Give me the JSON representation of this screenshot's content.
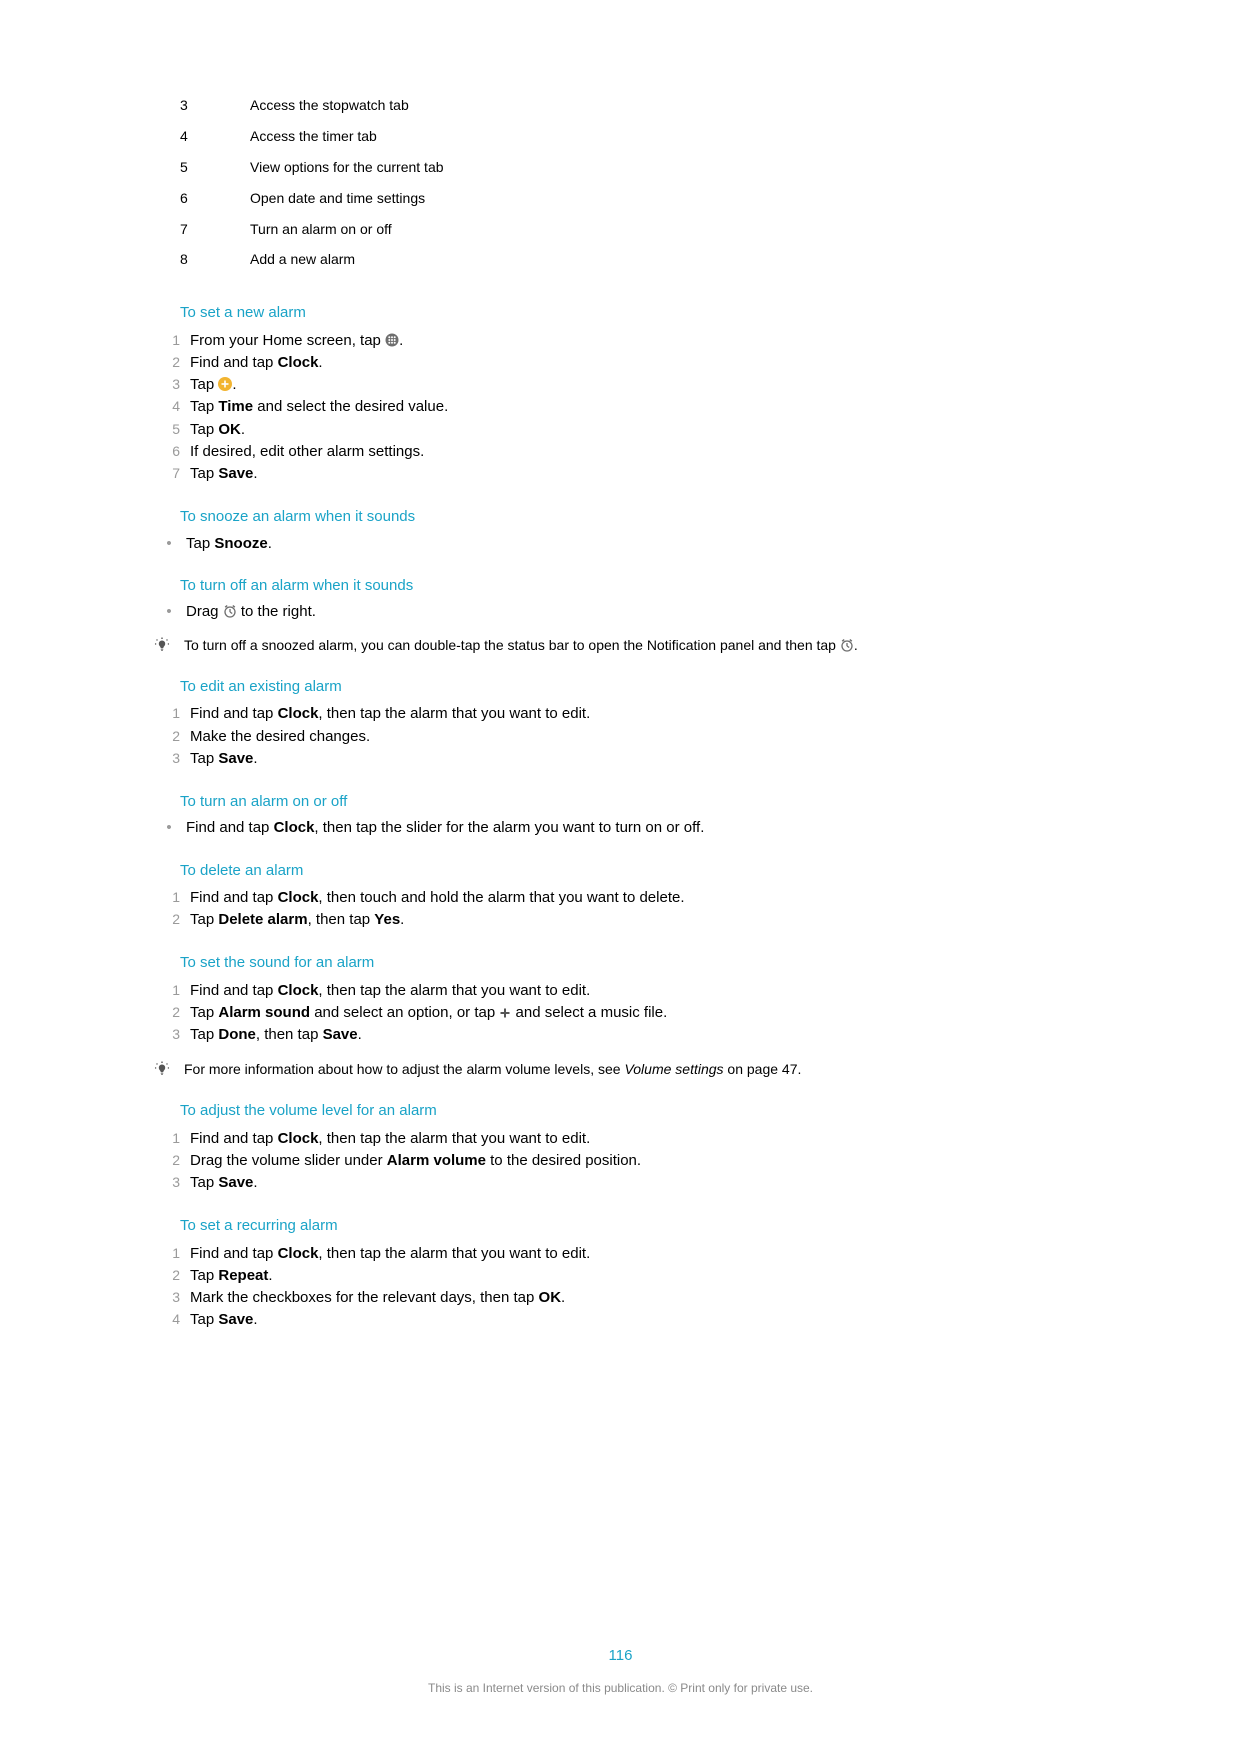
{
  "legend": [
    {
      "n": "3",
      "text": "Access the stopwatch tab"
    },
    {
      "n": "4",
      "text": "Access the timer tab"
    },
    {
      "n": "5",
      "text": "View options for the current tab"
    },
    {
      "n": "6",
      "text": "Open date and time settings"
    },
    {
      "n": "7",
      "text": "Turn an alarm on or off"
    },
    {
      "n": "8",
      "text": "Add a new alarm"
    }
  ],
  "s1": {
    "heading": "To set a new alarm",
    "steps": {
      "n1": "1",
      "t1a": "From your Home screen, tap ",
      "t1b": ".",
      "n2": "2",
      "t2a": "Find and tap ",
      "t2b": "Clock",
      "t2c": ".",
      "n3": "3",
      "t3a": "Tap ",
      "t3b": ".",
      "n4": "4",
      "t4a": "Tap ",
      "t4b": "Time",
      "t4c": " and select the desired value.",
      "n5": "5",
      "t5a": "Tap ",
      "t5b": "OK",
      "t5c": ".",
      "n6": "6",
      "t6": "If desired, edit other alarm settings.",
      "n7": "7",
      "t7a": "Tap ",
      "t7b": "Save",
      "t7c": "."
    }
  },
  "s2": {
    "heading": "To snooze an alarm when it sounds",
    "bullet": {
      "ta": "Tap ",
      "tb": "Snooze",
      "tc": "."
    }
  },
  "s3": {
    "heading": "To turn off an alarm when it sounds",
    "bullet": {
      "ta": "Drag ",
      "tb": " to the right."
    },
    "tip": {
      "ta": "To turn off a snoozed alarm, you can double-tap the status bar to open the Notification panel and then tap ",
      "tb": "."
    }
  },
  "s4": {
    "heading": "To edit an existing alarm",
    "steps": {
      "n1": "1",
      "t1a": "Find and tap ",
      "t1b": "Clock",
      "t1c": ", then tap the alarm that you want to edit.",
      "n2": "2",
      "t2": "Make the desired changes.",
      "n3": "3",
      "t3a": "Tap ",
      "t3b": "Save",
      "t3c": "."
    }
  },
  "s5": {
    "heading": "To turn an alarm on or off",
    "bullet": {
      "ta": "Find and tap ",
      "tb": "Clock",
      "tc": ", then tap the slider for the alarm you want to turn on or off."
    }
  },
  "s6": {
    "heading": "To delete an alarm",
    "steps": {
      "n1": "1",
      "t1a": "Find and tap ",
      "t1b": "Clock",
      "t1c": ", then touch and hold the alarm that you want to delete.",
      "n2": "2",
      "t2a": "Tap ",
      "t2b": "Delete alarm",
      "t2c": ", then tap ",
      "t2d": "Yes",
      "t2e": "."
    }
  },
  "s7": {
    "heading": "To set the sound for an alarm",
    "steps": {
      "n1": "1",
      "t1a": "Find and tap ",
      "t1b": "Clock",
      "t1c": ", then tap the alarm that you want to edit.",
      "n2": "2",
      "t2a": "Tap ",
      "t2b": "Alarm sound",
      "t2c": " and select an option, or tap ",
      "t2d": " and select a music file.",
      "n3": "3",
      "t3a": "Tap ",
      "t3b": "Done",
      "t3c": ", then tap ",
      "t3d": "Save",
      "t3e": "."
    },
    "tip": {
      "ta": "For more information about how to adjust the alarm volume levels, see ",
      "tb": "Volume settings",
      "tc": " on page 47."
    }
  },
  "s8": {
    "heading": "To adjust the volume level for an alarm",
    "steps": {
      "n1": "1",
      "t1a": "Find and tap ",
      "t1b": "Clock",
      "t1c": ", then tap the alarm that you want to edit.",
      "n2": "2",
      "t2a": "Drag the volume slider under ",
      "t2b": "Alarm volume",
      "t2c": " to the desired position.",
      "n3": "3",
      "t3a": "Tap ",
      "t3b": "Save",
      "t3c": "."
    }
  },
  "s9": {
    "heading": "To set a recurring alarm",
    "steps": {
      "n1": "1",
      "t1a": "Find and tap ",
      "t1b": "Clock",
      "t1c": ", then tap the alarm that you want to edit.",
      "n2": "2",
      "t2a": "Tap ",
      "t2b": "Repeat",
      "t2c": ".",
      "n3": "3",
      "t3a": "Mark the checkboxes for the relevant days, then tap ",
      "t3b": "OK",
      "t3c": ".",
      "n4": "4",
      "t4a": "Tap ",
      "t4b": "Save",
      "t4c": "."
    }
  },
  "page_number": "116",
  "footer": "This is an Internet version of this publication. © Print only for private use."
}
